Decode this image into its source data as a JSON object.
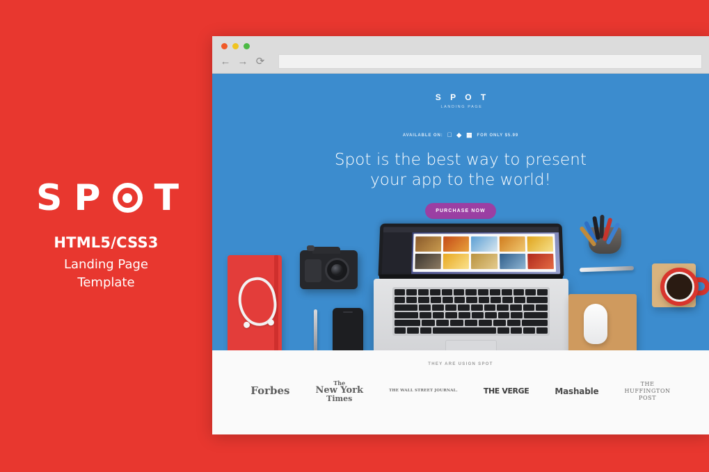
{
  "colors": {
    "background_red": "#e8372f",
    "hero_blue": "#3c8cce",
    "cta_purple": "#9b3fa3",
    "clients_bg": "#fafafa",
    "chrome_gray": "#dcdcdc"
  },
  "brand_panel": {
    "logo_letters": [
      "S",
      "P",
      "T"
    ],
    "logo_mark": "target-icon",
    "subtitle_primary": "HTML5/CSS3",
    "subtitle_line1": "Landing Page",
    "subtitle_line2": "Template"
  },
  "browser": {
    "traffic_lights": [
      "close",
      "minimize",
      "maximize"
    ],
    "back_icon": "←",
    "forward_icon": "→",
    "reload_icon": "⟳",
    "url_value": "",
    "url_placeholder": ""
  },
  "hero": {
    "logo_word": "S P O T",
    "logo_sub": "LANDING PAGE",
    "available_label": "AVAILABLE ON:",
    "platform_icons": [
      "apple-icon",
      "android-icon",
      "windows-icon"
    ],
    "price_label": "FOR ONLY $5.99",
    "headline_line1": "Spot is the best way to present",
    "headline_line2": "your app to the world!",
    "cta_label": "PURCHASE NOW"
  },
  "desk": {
    "items": [
      "red-notebook",
      "white-earbuds",
      "digital-camera",
      "silver-pen",
      "black-smartphone",
      "macbook-pro-laptop",
      "pen-cup",
      "magic-mouse",
      "tan-mousepad",
      "red-coffee-cup",
      "wooden-coaster"
    ]
  },
  "clients": {
    "title": "THEY ARE USIGN SPOT",
    "logos": [
      {
        "name": "Forbes",
        "line1": "Forbes"
      },
      {
        "name": "The New York Times",
        "line1": "The",
        "line2": "New York",
        "line3": "Times"
      },
      {
        "name": "The Wall Street Journal",
        "line1": "THE WALL STREET JOURNAL."
      },
      {
        "name": "The Verge",
        "line1": "THE VERGE"
      },
      {
        "name": "Mashable",
        "line1": "Mashable"
      },
      {
        "name": "The Huffington Post",
        "line1": "THE",
        "line2": "HUFFINGTON",
        "line3": "POST"
      }
    ]
  }
}
